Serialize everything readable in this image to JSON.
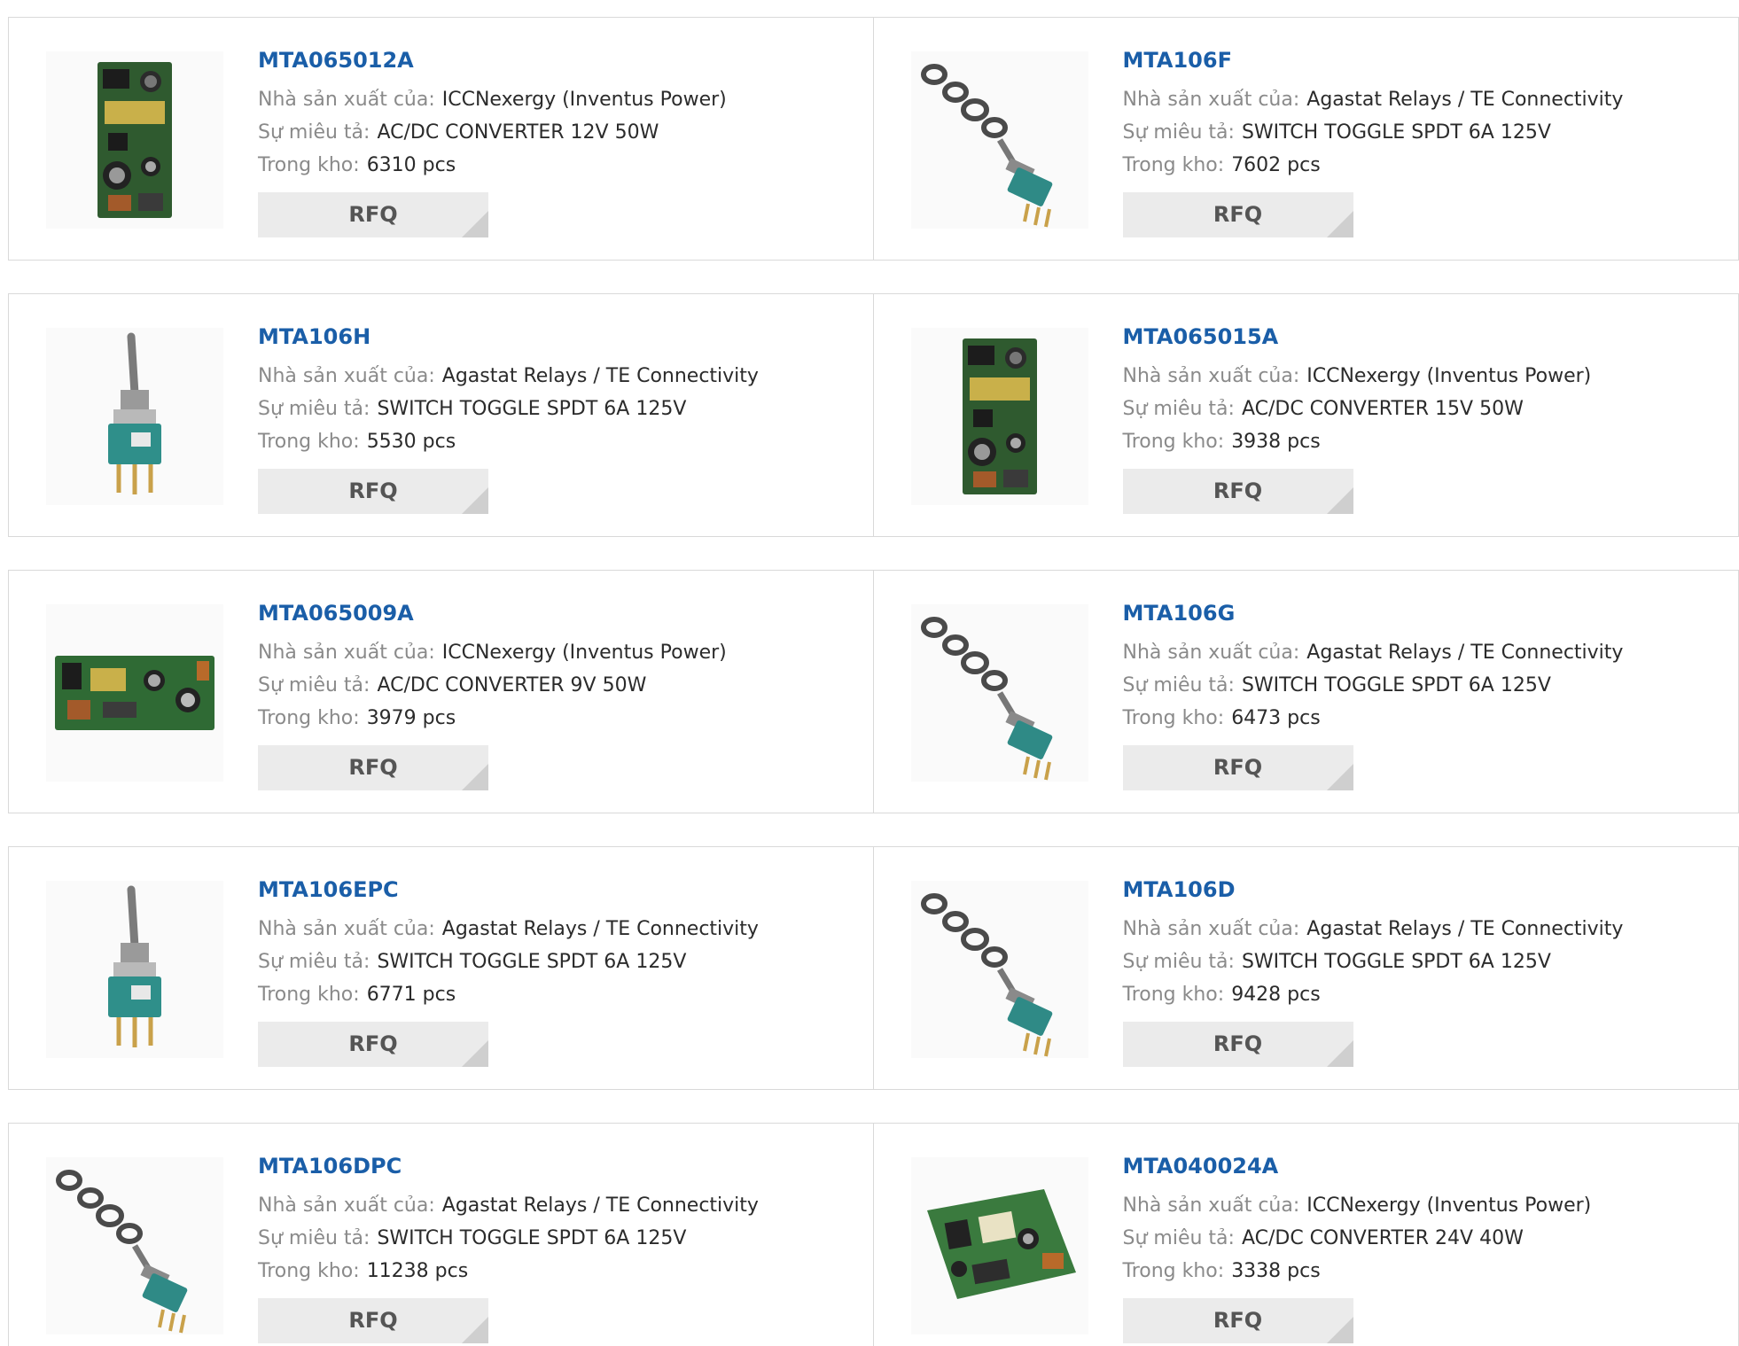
{
  "labels": {
    "manufacturer": "Nhà sản xuất của:",
    "description": "Sự miêu tả:",
    "stock": "Trong kho:",
    "rfq": "RFQ"
  },
  "products": [
    {
      "part": "MTA065012A",
      "manufacturer": "ICCNexergy (Inventus Power)",
      "description": "AC/DC CONVERTER 12V 50W",
      "stock": "6310 pcs",
      "image": "pcb-vertical"
    },
    {
      "part": "MTA106F",
      "manufacturer": "Agastat Relays / TE Connectivity",
      "description": "SWITCH TOGGLE SPDT 6A 125V",
      "stock": "7602 pcs",
      "image": "toggle-switch-rings"
    },
    {
      "part": "MTA106H",
      "manufacturer": "Agastat Relays / TE Connectivity",
      "description": "SWITCH TOGGLE SPDT 6A 125V",
      "stock": "5530 pcs",
      "image": "toggle-switch-upright"
    },
    {
      "part": "MTA065015A",
      "manufacturer": "ICCNexergy (Inventus Power)",
      "description": "AC/DC CONVERTER 15V 50W",
      "stock": "3938 pcs",
      "image": "pcb-vertical"
    },
    {
      "part": "MTA065009A",
      "manufacturer": "ICCNexergy (Inventus Power)",
      "description": "AC/DC CONVERTER 9V 50W",
      "stock": "3979 pcs",
      "image": "pcb-horizontal"
    },
    {
      "part": "MTA106G",
      "manufacturer": "Agastat Relays / TE Connectivity",
      "description": "SWITCH TOGGLE SPDT 6A 125V",
      "stock": "6473 pcs",
      "image": "toggle-switch-rings"
    },
    {
      "part": "MTA106EPC",
      "manufacturer": "Agastat Relays / TE Connectivity",
      "description": "SWITCH TOGGLE SPDT 6A 125V",
      "stock": "6771 pcs",
      "image": "toggle-switch-upright"
    },
    {
      "part": "MTA106D",
      "manufacturer": "Agastat Relays / TE Connectivity",
      "description": "SWITCH TOGGLE SPDT 6A 125V",
      "stock": "9428 pcs",
      "image": "toggle-switch-rings"
    },
    {
      "part": "MTA106DPC",
      "manufacturer": "Agastat Relays / TE Connectivity",
      "description": "SWITCH TOGGLE SPDT 6A 125V",
      "stock": "11238 pcs",
      "image": "toggle-switch-rings"
    },
    {
      "part": "MTA040024A",
      "manufacturer": "ICCNexergy (Inventus Power)",
      "description": "AC/DC CONVERTER 24V 40W",
      "stock": "3338 pcs",
      "image": "pcb-angled"
    }
  ],
  "colors": {
    "link": "#1a5ea8",
    "label": "#8a8a8a",
    "value": "#2b2b2b",
    "button_bg": "#ebebeb",
    "border": "#d9d9d9"
  }
}
